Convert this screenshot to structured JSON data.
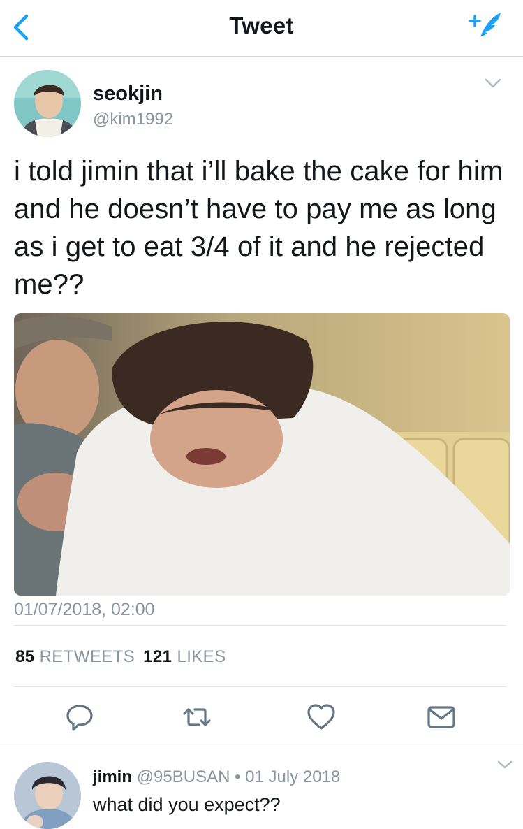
{
  "nav": {
    "title": "Tweet",
    "back_icon": "chevron-left-icon",
    "compose_icon": "compose-feather-icon",
    "accent": "#1da1f2"
  },
  "tweet": {
    "user": {
      "name": "seokjin",
      "handle": "@kim1992"
    },
    "text": "i told jimin that i’ll bake the cake for him and he doesn’t have to pay me as long as i get to eat 3/4 of it and he rejected me??",
    "timestamp": "01/07/2018, 02:00",
    "stats": {
      "retweets_count": "85",
      "retweets_label": "RETWEETS",
      "likes_count": "121",
      "likes_label": "LIKES"
    },
    "actions": [
      "reply-icon",
      "retweet-icon",
      "like-heart-icon",
      "direct-message-icon"
    ]
  },
  "reply": {
    "name": "jimin",
    "meta": "@95BUSAN • 01 July 2018",
    "text": "what did you expect??"
  },
  "colors": {
    "text": "#14171a",
    "secondary": "#8a959e",
    "divider": "#dfe3e6"
  }
}
